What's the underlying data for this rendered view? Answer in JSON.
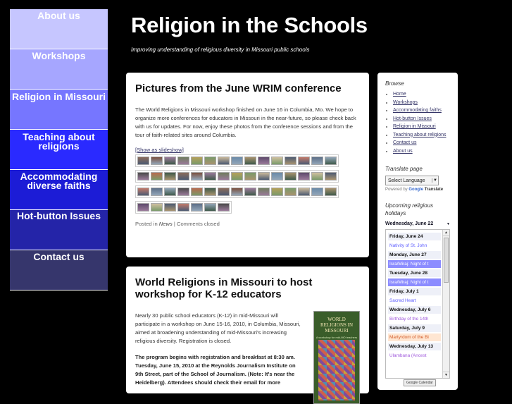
{
  "nav": [
    {
      "label": "About us",
      "color": "#c6c6ff"
    },
    {
      "label": "Workshops",
      "color": "#a6a6ff"
    },
    {
      "label": "Religion in Missouri",
      "color": "#7676ff"
    },
    {
      "label": "Teaching about religions",
      "color": "#2a2aff"
    },
    {
      "label": "Accommodating diverse faiths",
      "color": "#1c1cd6"
    },
    {
      "label": "Hot-button Issues",
      "color": "#2424a8"
    },
    {
      "label": "Contact us",
      "color": "#36366c"
    }
  ],
  "site": {
    "title": "Religion in the Schools",
    "tagline": "Improving understanding of religious diversity in Missouri public schools"
  },
  "post1": {
    "title": "Pictures from the June WRIM conference",
    "body": "The World Religions in Missouri workshop finished on June 16 in Columbia, Mo. We hope to organize more conferences for educators in Missouri in the near-future, so please check back with us for updates. For now, enjoy these photos from the conference sessions and from the tour of faith-related sites around Columbia.",
    "slideshow_link": "[Show as slideshow]",
    "meta_prefix": "Posted in",
    "meta_category": "News",
    "meta_sep": "|",
    "meta_comments": "Comments closed"
  },
  "post2": {
    "title": "World Religions in Missouri to host workshop for K-12 educators",
    "body": "Nearly 30 public school educators (K-12) in mid-Missouri will participate in a workshop on June 15-16, 2010, in Columbia, Missouri, aimed at broadening understanding of mid-Missouri's increasing religious diversity. Registration is closed.",
    "bold_body": "The program begins with registration and breakfast at 8:30 am. Tuesday, June 15, 2010 at the Reynolds Journalism Institute on 9th Street, part of the School of Journalism. (Note: It's near the Heidelberg). Attendees should check their email for more",
    "poster_title": "WORLD RELIGIONS IN MISSOURI",
    "poster_sub": "A workshop for mid-MO teachers June 15-16"
  },
  "sidebar": {
    "browse_heading": "Browse",
    "browse_links": [
      "Home",
      "Workshops",
      "Accommodating faiths",
      "Hot-button Issues",
      "Religion in Missouri",
      "Teaching about religions",
      "Contact us",
      "About us"
    ],
    "translate_heading": "Translate page",
    "translate_select": "Select Language",
    "powered_by": "Powered by",
    "powered_google": "Google",
    "powered_translate": "Translate",
    "holidays_heading": "Upcoming religious holidays",
    "calendar_selected": "Wednesday, June 22",
    "calendar_button": "Google Calendar",
    "calendar_items": [
      {
        "kind": "day",
        "text": "Friday, June 24"
      },
      {
        "kind": "event",
        "text": "Nativity of St. John",
        "bg": "#ffffff",
        "color": "#5a5aff"
      },
      {
        "kind": "day",
        "text": "Monday, June 27"
      },
      {
        "kind": "event",
        "text": "Isra/Miraj: Night of t",
        "bg": "#8c8cff",
        "color": "#ffffff"
      },
      {
        "kind": "day",
        "text": "Tuesday, June 28"
      },
      {
        "kind": "event",
        "text": "Isra/Miraj: Night of t",
        "bg": "#8c8cff",
        "color": "#ffffff"
      },
      {
        "kind": "day",
        "text": "Friday, July 1"
      },
      {
        "kind": "event",
        "text": "Sacred Heart",
        "bg": "#ffffff",
        "color": "#5a5aff"
      },
      {
        "kind": "day",
        "text": "Wednesday, July 6"
      },
      {
        "kind": "event",
        "text": "Birthday of the 14th",
        "bg": "#ffffff",
        "color": "#a05adc"
      },
      {
        "kind": "day",
        "text": "Saturday, July 9"
      },
      {
        "kind": "event",
        "text": "Martyrdom of the Bi",
        "bg": "#ffe6d2",
        "color": "#d25a28"
      },
      {
        "kind": "day",
        "text": "Wednesday, July 13"
      },
      {
        "kind": "event",
        "text": "Ulambana (Ancest",
        "bg": "#ffffff",
        "color": "#a05adc"
      }
    ]
  }
}
